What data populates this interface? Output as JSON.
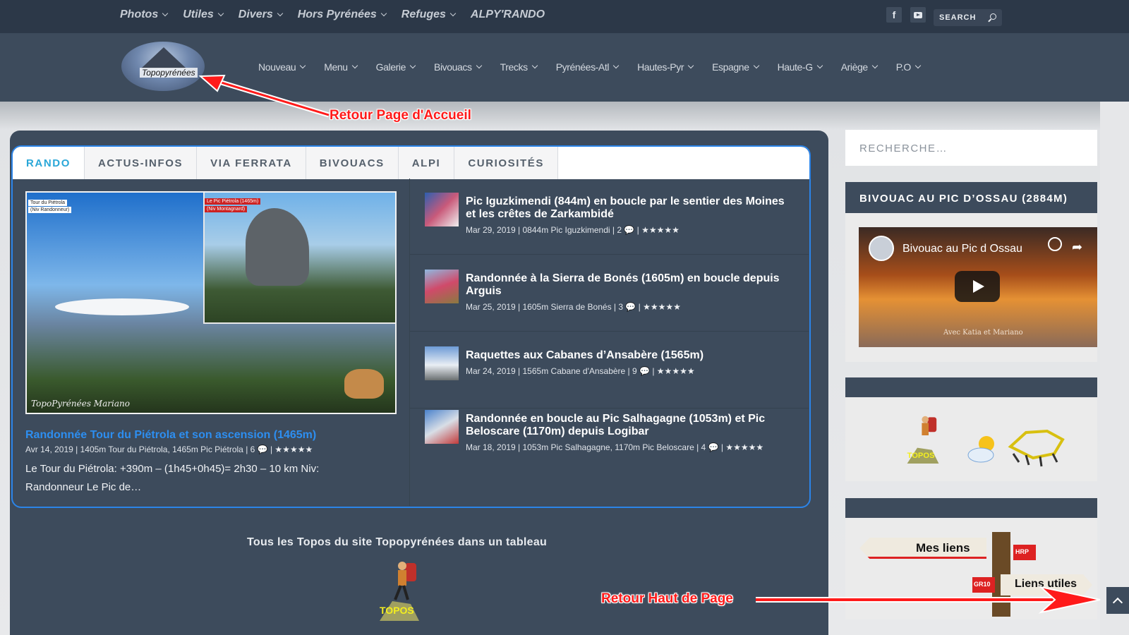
{
  "top_nav": [
    {
      "label": "Photos"
    },
    {
      "label": "Utiles"
    },
    {
      "label": "Divers"
    },
    {
      "label": "Hors Pyrénées"
    },
    {
      "label": "Refuges"
    },
    {
      "label": "ALPY'RANDO"
    }
  ],
  "social": {
    "facebook_glyph": "f",
    "icons": [
      "facebook-icon",
      "youtube-icon"
    ]
  },
  "top_search": {
    "label": "SEARCH"
  },
  "logo": {
    "text": "Topopyrénées"
  },
  "main_nav": [
    {
      "label": "Nouveau"
    },
    {
      "label": "Menu"
    },
    {
      "label": "Galerie"
    },
    {
      "label": "Bivouacs"
    },
    {
      "label": "Trecks"
    },
    {
      "label": "Pyrénées-Atl"
    },
    {
      "label": "Hautes-Pyr"
    },
    {
      "label": "Espagne"
    },
    {
      "label": "Haute-G"
    },
    {
      "label": "Ariège"
    },
    {
      "label": "P.O"
    }
  ],
  "annotations": {
    "home": "Retour Page d'Accueil",
    "top": "Retour Haut de Page"
  },
  "tabs": [
    {
      "label": "RANDO",
      "active": true
    },
    {
      "label": "ACTUS-INFOS"
    },
    {
      "label": "VIA FERRATA"
    },
    {
      "label": "BIVOUACS"
    },
    {
      "label": "ALPI"
    },
    {
      "label": "CURIOSITÉS"
    }
  ],
  "featured": {
    "image_tags": [
      "Tour du Piétrola",
      "(Niv Randonneur)",
      "Le Pic Piétrola (1465m)",
      "(Niv Montagnard)"
    ],
    "image_signature": "TopoPyrénées Mariano",
    "title": "Randonnée Tour du Piétrola et son ascension (1465m)",
    "meta": "Avr 14, 2019 | 1405m Tour du Piétrola, 1465m Pic Piétrola | 6",
    "stars": "★★★★★",
    "excerpt": "Le Tour du Piétrola: +390m – (1h45+0h45)= 2h30 – 10 km Niv: Randonneur Le Pic de…"
  },
  "posts": [
    {
      "title": "Pic Iguzkimendi (844m) en boucle par le sentier des Moines et les crêtes de Zarkambidé",
      "meta": "Mar 29, 2019 | 0844m Pic Iguzkimendi | 2",
      "sep": "|",
      "stars": "★★★★★"
    },
    {
      "title": "Randonnée à la Sierra de Bonés (1605m) en boucle depuis Arguis",
      "meta": "Mar 25, 2019 | 1605m Sierra de Bonés | 3",
      "sep": "|",
      "stars": "★★★★★"
    },
    {
      "title": "Raquettes aux Cabanes d’Ansabère (1565m)",
      "meta": "Mar 24, 2019 | 1565m Cabane d'Ansabère | 9",
      "sep": "|",
      "stars": "★★★★★"
    },
    {
      "title": "Randonnée en boucle au Pic Salhagagne (1053m) et Pic Beloscare (1170m) depuis Logibar",
      "meta": "Mar 18, 2019 | 1053m Pic Salhagagne, 1170m Pic Beloscare | 4",
      "sep": "|",
      "stars": "★★★★★"
    }
  ],
  "topos": {
    "heading": "Tous les Topos du site Topopyrénées dans un tableau",
    "badge": "TOPOS"
  },
  "sidebar": {
    "search_placeholder": "RECHERCHE…",
    "bivouac": {
      "heading": "BIVOUAC AU PIC D’OSSAU (2884M)",
      "video_title": "Bivouac au Pic d Ossau",
      "video_subtitle": "Avec Katia et Mariano"
    },
    "links_sign": {
      "left": "Mes liens",
      "right": "Liens utiles",
      "tag_hrp": "HRP",
      "tag_gr10": "GR10"
    }
  }
}
